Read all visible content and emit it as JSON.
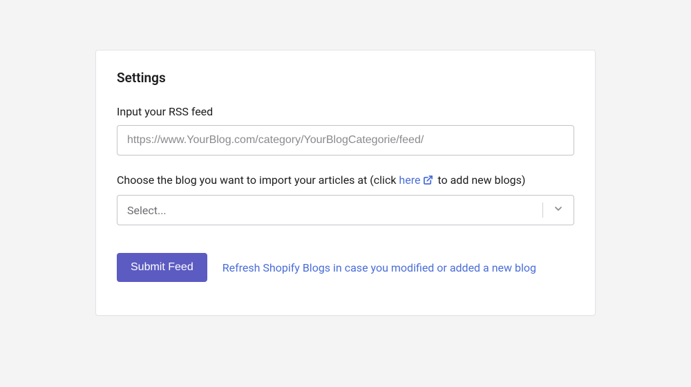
{
  "settings": {
    "title": "Settings",
    "rss_label": "Input your RSS feed",
    "rss_placeholder": "https://www.YourBlog.com/category/YourBlogCategorie/feed/",
    "rss_value": "",
    "choose_prefix": "Choose the blog you want to import your articles at (click ",
    "choose_link": "here",
    "choose_suffix": " to add new blogs)",
    "select_placeholder": "Select...",
    "submit_label": "Submit Feed",
    "refresh_label": "Refresh Shopify Blogs in case you modified or added a new blog"
  }
}
